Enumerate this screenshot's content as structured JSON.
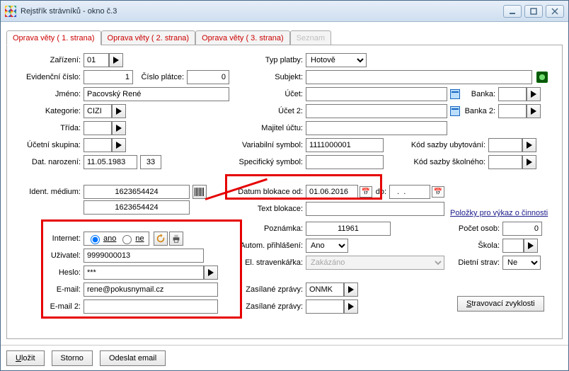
{
  "window": {
    "title": "Rejstřík strávníků - okno č.3"
  },
  "tabs": {
    "t1": "Oprava věty ( 1. strana)",
    "t2": "Oprava věty ( 2. strana)",
    "t3": "Oprava věty ( 3. strana)",
    "t4": "Seznam"
  },
  "labels": {
    "zarizeni": "Zařízení:",
    "evid": "Evidenční číslo:",
    "cisloplatce": "Číslo plátce:",
    "jmeno": "Jméno:",
    "kategorie": "Kategorie:",
    "trida": "Třída:",
    "ucetni": "Účetní skupina:",
    "datnar": "Dat. narození:",
    "ident": "Ident. médium:",
    "internet": "Internet:",
    "uzivatel": "Uživatel:",
    "heslo": "Heslo:",
    "email": "E-mail:",
    "email2": "E-mail 2:",
    "typplatby": "Typ platby:",
    "subjekt": "Subjekt:",
    "ucet": "Účet:",
    "ucet2": "Účet 2:",
    "majitel": "Majitel účtu:",
    "varsym": "Variabilní symbol:",
    "specsym": "Specifický symbol:",
    "datumblok": "Datum blokace od:",
    "do": "do:",
    "textblok": "Text blokace:",
    "poznamka": "Poznámka:",
    "autom": "Autom. přihlášení:",
    "elstrav": "El. stravenkářka:",
    "zaszpr": "Zasílané zprávy:",
    "zaszpr2": "Zasílané zprávy:",
    "banka": "Banka:",
    "banka2": "Banka 2:",
    "kodubyt": "Kód sazby ubytování:",
    "kodskol": "Kód sazby školného:",
    "polozky": "Položky pro výkaz o činnosti",
    "pocet": "Počet osob:",
    "skola": "Škola:",
    "dietni": "Dietní strav:",
    "ano_radio": "ano",
    "ne_radio": "ne"
  },
  "values": {
    "zarizeni": "01",
    "evid": "1",
    "cisloplatce": "0",
    "jmeno": "Pacovský René",
    "kategorie": "CIZI",
    "trida": "",
    "ucetni": "",
    "datnar": "11.05.1983",
    "vek": "33",
    "ident": "1623654424",
    "ident2": "1623654424",
    "uzivatel": "9999000013",
    "heslo": "***",
    "email": "rene@pokusnymail.cz",
    "email2": "",
    "typplatby": "Hotově",
    "subjekt": "",
    "ucet": "",
    "ucet2": "",
    "majitel": "",
    "varsym": "1111000001",
    "specsym": "",
    "datumblok_od": "01.06.2016",
    "datumblok_do": "  .  .",
    "textblok": "",
    "poznamka": "11961",
    "autom": "Ano",
    "elstrav": "Zakázáno",
    "zaszpr": "ONMK",
    "zaszpr2": "",
    "banka": "",
    "banka2": "",
    "kodubyt": "",
    "kodskol": "",
    "pocet": "0",
    "skola": "",
    "dietni": "Ne"
  },
  "buttons": {
    "stravzvyk": "Stravovací zvyklosti",
    "ulozit": "Uložit",
    "storno": "Storno",
    "odeslat": "Odeslat email"
  }
}
